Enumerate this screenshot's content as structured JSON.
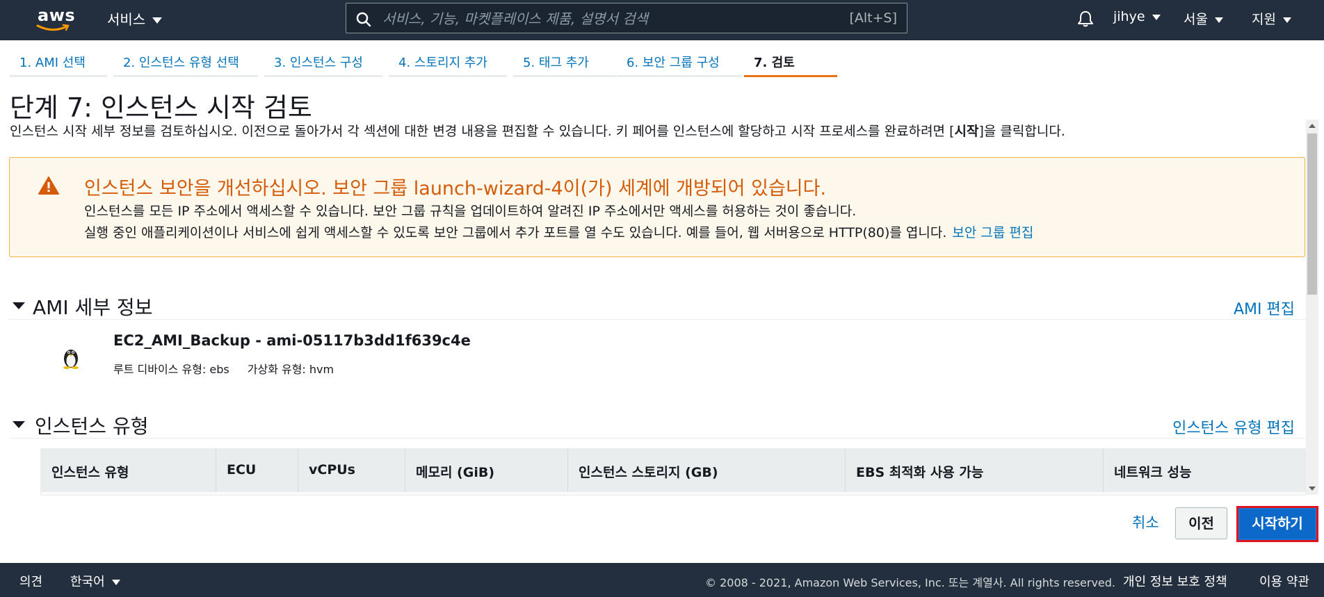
{
  "nav": {
    "logo_text": "aws",
    "services_label": "서비스",
    "search_placeholder": "서비스, 기능, 마켓플레이스 제품, 설명서 검색",
    "search_shortcut": "[Alt+S]",
    "user": "jihye",
    "region": "서울",
    "support": "지원"
  },
  "tabs": [
    {
      "label": "1. AMI 선택"
    },
    {
      "label": "2. 인스턴스 유형 선택"
    },
    {
      "label": "3. 인스턴스 구성"
    },
    {
      "label": "4. 스토리지 추가"
    },
    {
      "label": "5. 태그 추가"
    },
    {
      "label": "6. 보안 그룹 구성"
    },
    {
      "label": "7. 검토"
    }
  ],
  "page": {
    "title": "단계 7: 인스턴스 시작 검토",
    "desc_pre": "인스턴스 시작 세부 정보를 검토하십시오. 이전으로 돌아가서 각 섹션에 대한 변경 내용을 편집할 수 있습니다. 키 페어를 인스턴스에 할당하고 시작 프로세스를 완료하려면 [",
    "desc_bold": "시작",
    "desc_post": "]을 클릭합니다."
  },
  "warning": {
    "title": "인스턴스 보안을 개선하십시오. 보안 그룹 launch-wizard-4이(가) 세계에 개방되어 있습니다.",
    "line1": "인스턴스를 모든 IP 주소에서 액세스할 수 있습니다. 보안 그룹 규칙을 업데이트하여 알려진 IP 주소에서만 액세스를 허용하는 것이 좋습니다.",
    "line2": "실행 중인 애플리케이션이나 서비스에 쉽게 액세스할 수 있도록 보안 그룹에서 추가 포트를 열 수도 있습니다. 예를 들어, 웹 서버용으로 HTTP(80)를 엽니다.",
    "link": "보안 그룹 편집",
    "color": "#d45b07"
  },
  "ami": {
    "section_title": "AMI 세부 정보",
    "edit_link": "AMI 편집",
    "name": "EC2_AMI_Backup - ami-05117b3dd1f639c4e",
    "root_device": "루트 디바이스 유형: ebs",
    "virtualization": "가상화 유형: hvm",
    "icon": "linux-tux-icon"
  },
  "instance_type": {
    "section_title": "인스턴스 유형",
    "edit_link": "인스턴스 유형 편집",
    "columns": [
      "인스턴스 유형",
      "ECU",
      "vCPUs",
      "메모리 (GiB)",
      "인스턴스 스토리지 (GB)",
      "EBS 최적화 사용 가능",
      "네트워크 성능"
    ]
  },
  "actions": {
    "cancel": "취소",
    "previous": "이전",
    "launch": "시작하기"
  },
  "footer": {
    "feedback": "의견",
    "language": "한국어",
    "copyright": "© 2008 - 2021, Amazon Web Services, Inc. 또는 계열사. All rights reserved.",
    "privacy": "개인 정보 보호 정책",
    "terms": "이용 약관"
  },
  "colors": {
    "nav_bg": "#232f3e",
    "accent": "#ec7211",
    "link": "#0073bb",
    "primary_button": "#0d69c9",
    "highlight_border": "#e0141e"
  }
}
